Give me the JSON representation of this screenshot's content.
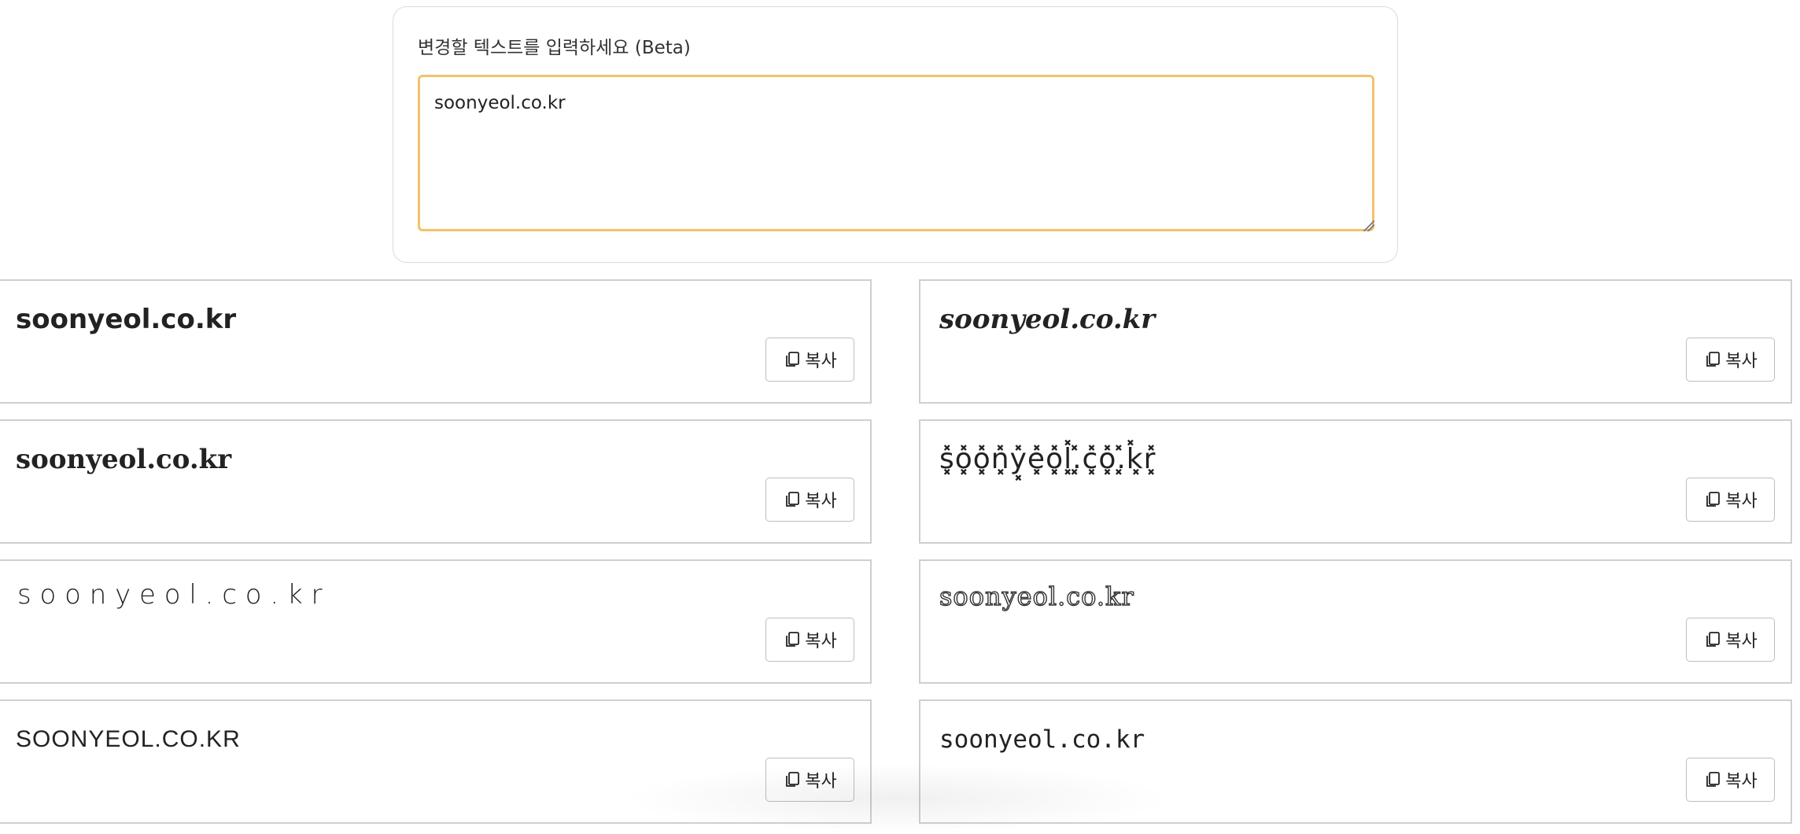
{
  "input": {
    "label": "변경할 텍스트를 입력하세요 (Beta)",
    "value": "soonyeol.co.kr"
  },
  "copy_label": "복사",
  "results": [
    {
      "text": "soonyeol.co.kr"
    },
    {
      "text": "soonyeol.co.kr"
    },
    {
      "text": "soonyeol.co.kr"
    },
    {
      "text": "s͓̽o͓̽o͓̽n͓̽y͓̽e͓̽o͓̽l͓̽.͓̽c͓̽o͓̽.͓̽k͓̽r͓̽"
    },
    {
      "text": "s o o n y e o l . c o . k r"
    },
    {
      "text": "soonyeol.co.kr"
    },
    {
      "text": "SOONYEOL.CO.KR"
    },
    {
      "text": "soonyeol.co.kr"
    }
  ]
}
